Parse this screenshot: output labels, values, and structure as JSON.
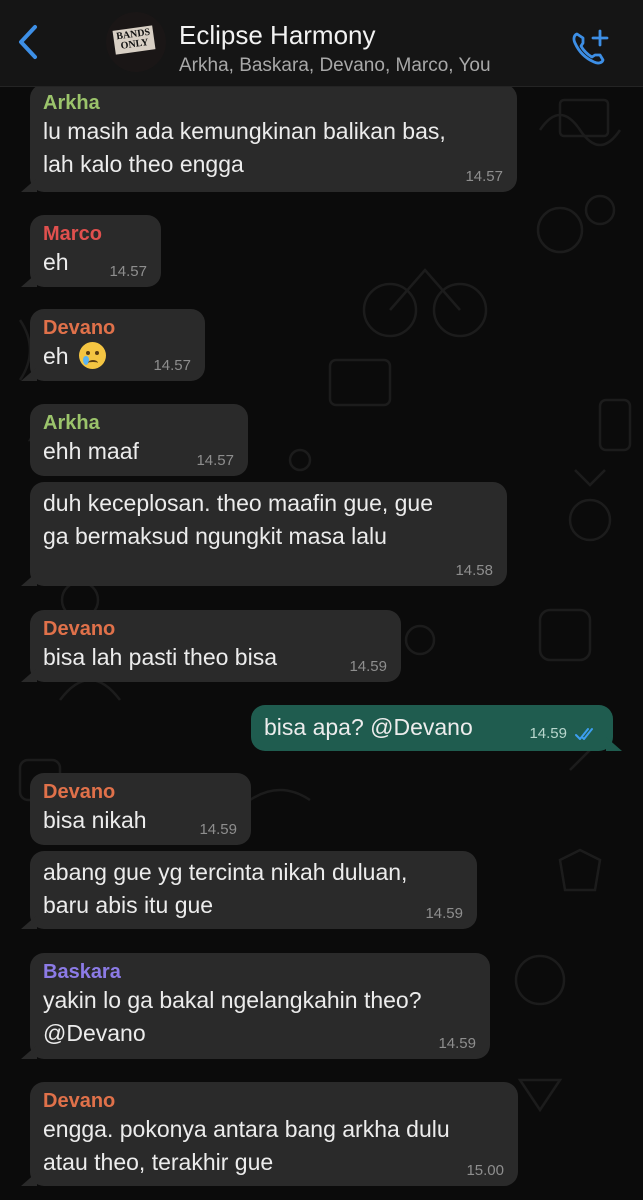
{
  "header": {
    "title": "Eclipse Harmony",
    "members": "Arkha, Baskara, Devano, Marco, You",
    "avatar_text": "BANDS ONLY"
  },
  "colors": {
    "Arkha": "#9bc46b",
    "Marco": "#e0504e",
    "Devano": "#e0714a",
    "Baskara": "#8c7be6",
    "accent": "#3d8fe6",
    "outgoing_bubble": "#1f5c4f",
    "incoming_bubble": "#2a2a2a"
  },
  "messages": [
    {
      "sender": "Arkha",
      "text": "lu masih ada kemungkinan balikan bas,\nlah kalo theo engga",
      "time": "14.57"
    },
    {
      "sender": "Marco",
      "text": "eh",
      "time": "14.57"
    },
    {
      "sender": "Devano",
      "text": "eh",
      "emoji": "crying-face",
      "time": "14.57"
    },
    {
      "sender": "Arkha",
      "text": "ehh maaf",
      "time": "14.57"
    },
    {
      "sender": "",
      "text": "duh keceplosan. theo maafin gue, gue\nga bermaksud ngungkit masa lalu",
      "time": "14.58"
    },
    {
      "sender": "Devano",
      "text": "bisa lah pasti theo bisa",
      "time": "14.59"
    },
    {
      "sender": "You",
      "text": "bisa apa? @Devano",
      "time": "14.59",
      "status": "read"
    },
    {
      "sender": "Devano",
      "text": "bisa nikah",
      "time": "14.59"
    },
    {
      "sender": "",
      "text": "abang gue yg tercinta nikah duluan,\nbaru abis itu gue",
      "time": "14.59"
    },
    {
      "sender": "Baskara",
      "text": "yakin lo ga bakal ngelangkahin theo?\n@Devano",
      "time": "14.59"
    },
    {
      "sender": "Devano",
      "text": "engga. pokonya antara bang arkha dulu\natau theo, terakhir gue",
      "time": "15.00"
    }
  ]
}
